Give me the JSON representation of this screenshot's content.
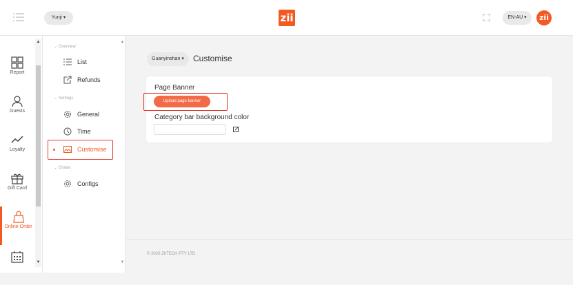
{
  "header": {
    "store_selector": "Yunji ▾",
    "logo_text": "zii",
    "language_selector": "EN-AU ▾",
    "avatar_text": "zii"
  },
  "rail": {
    "items": [
      {
        "label": "Report",
        "icon": "grid-icon"
      },
      {
        "label": "Guests",
        "icon": "user-icon"
      },
      {
        "label": "Loyalty",
        "icon": "trend-icon"
      },
      {
        "label": "Gift Card",
        "icon": "gift-icon"
      },
      {
        "label": "Online Order",
        "icon": "bag-icon",
        "active": true
      },
      {
        "label": "",
        "icon": "calendar-icon"
      }
    ]
  },
  "sidenav": {
    "sections": [
      {
        "title": "Overview",
        "items": [
          {
            "label": "List",
            "icon": "list-icon"
          },
          {
            "label": "Refunds",
            "icon": "refund-icon"
          }
        ]
      },
      {
        "title": "Settings",
        "items": [
          {
            "label": "General",
            "icon": "gear-icon"
          },
          {
            "label": "Time",
            "icon": "clock-icon"
          },
          {
            "label": "Customise",
            "icon": "image-icon",
            "active": true
          }
        ]
      },
      {
        "title": "Global",
        "items": [
          {
            "label": "Configs",
            "icon": "gear-icon"
          }
        ]
      }
    ]
  },
  "page": {
    "store_pill": "Guanyinshan ▾",
    "title": "Customise",
    "banner_label": "Page Banner",
    "upload_button": "Upload page banner",
    "color_label": "Category bar background color",
    "color_value": ""
  },
  "footer": {
    "copyright": "© 2020 ZIITECH PTY LTD"
  },
  "colors": {
    "accent": "#f25a22",
    "highlight_border": "#e23a2a"
  }
}
